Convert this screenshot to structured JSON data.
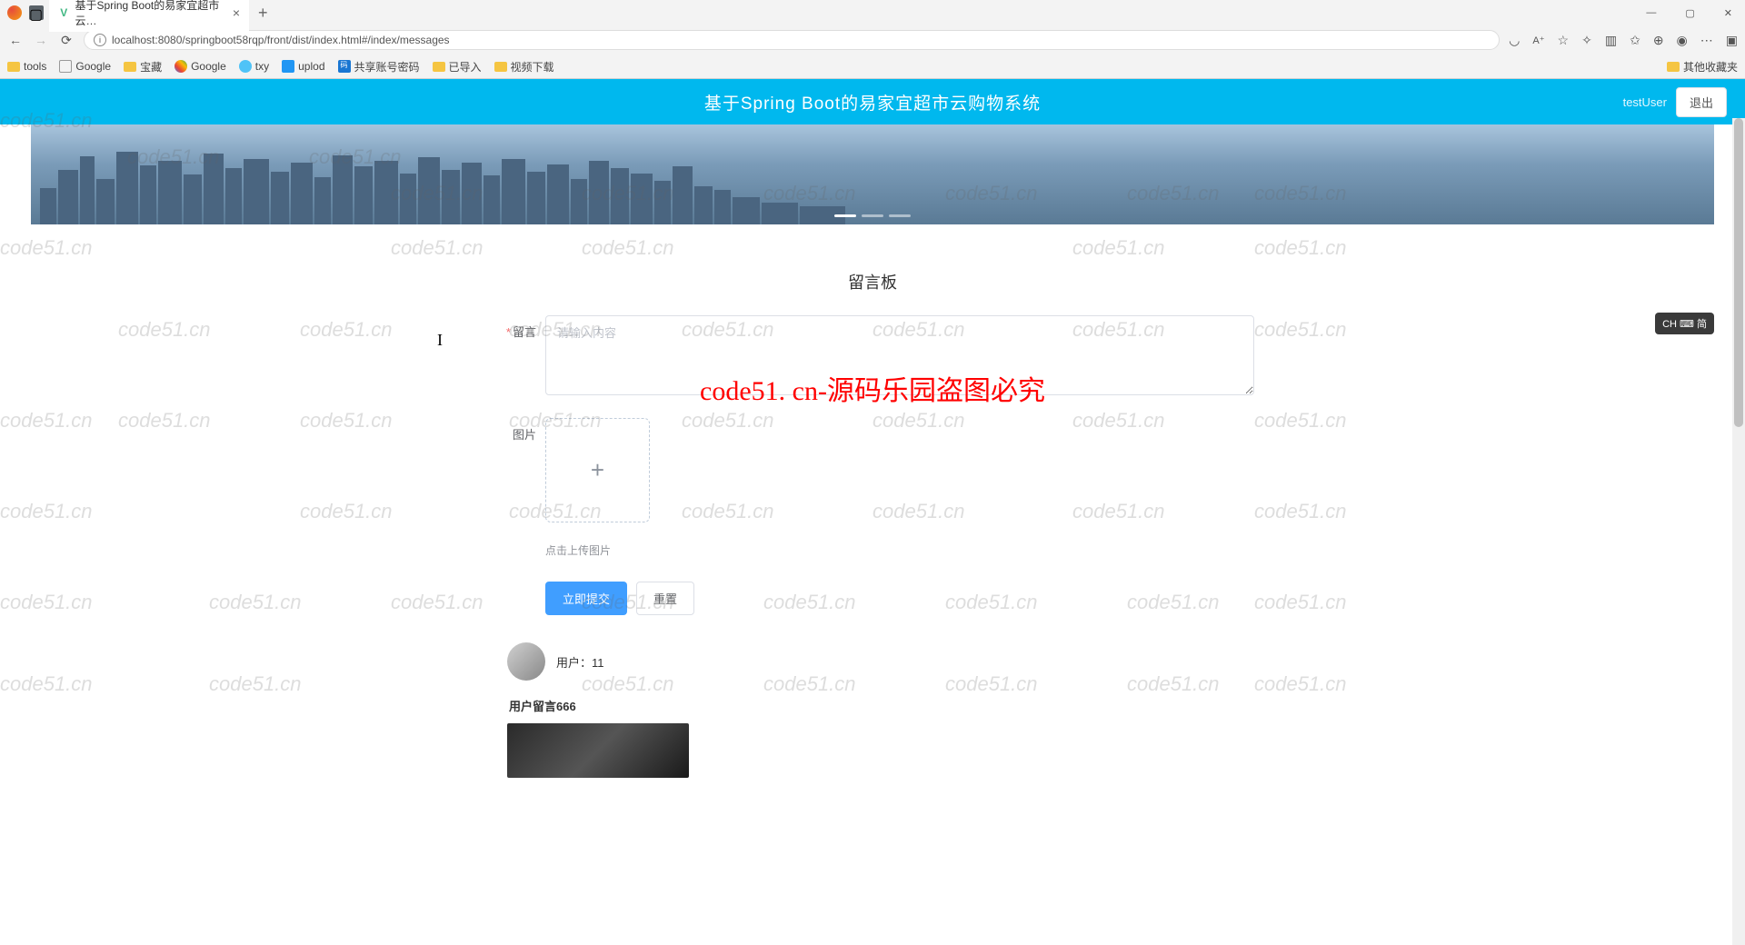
{
  "browser": {
    "tab_title": "基于Spring Boot的易家宜超市云…",
    "url": "localhost:8080/springboot58rqp/front/dist/index.html#/index/messages",
    "bookmarks": [
      "tools",
      "Google",
      "宝藏",
      "Google",
      "txy",
      "uplod",
      "共享账号密码",
      "已导入",
      "视频下载"
    ],
    "other_bookmarks": "其他收藏夹"
  },
  "header": {
    "site_title": "基于Spring Boot的易家宜超市云购物系统",
    "username": "testUser",
    "logout": "退出"
  },
  "page": {
    "title": "留言板",
    "message_label": "留言",
    "message_placeholder": "请输入内容",
    "image_label": "图片",
    "upload_hint": "点击上传图片",
    "submit_button": "立即提交",
    "reset_button": "重置"
  },
  "messages": [
    {
      "user_prefix": "用户：",
      "user_id": "11",
      "content": "用户留言666"
    }
  ],
  "watermark": {
    "repeat_text": "code51.cn",
    "center_text": "code51. cn-源码乐园盗图必究"
  },
  "ime": {
    "label": "CH ⌨ 简"
  }
}
